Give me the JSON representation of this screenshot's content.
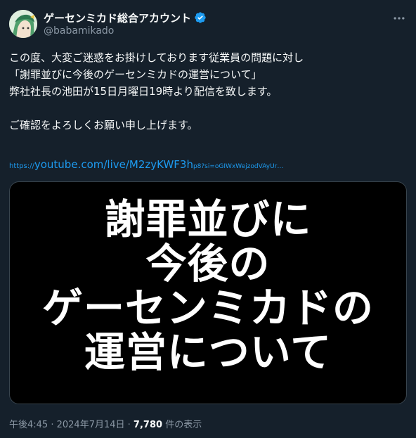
{
  "author": {
    "display_name": "ゲーセンミカド総合アカウント",
    "handle": "@babamikado",
    "verified_color": "#1d9bf0"
  },
  "tweet": {
    "lines": [
      "この度、大変ご迷惑をお掛けしております従業員の問題に対し",
      "「謝罪並びに今後のゲーセンミカドの運営について」",
      "弊社社長の池田が15日月曜日19時より配信を致します。",
      "",
      "ご確認をよろしくお願い申し上げます。"
    ],
    "link": {
      "protocol": "https://",
      "domain": "youtube.com/live/M2zyKWF3h",
      "rest": "p8?si=oGIWxWejzodVAyUr…"
    }
  },
  "media": {
    "title_lines": [
      "謝罪並びに",
      "今後の",
      "ゲーセンミカドの",
      "運営について"
    ]
  },
  "meta": {
    "time": "午後4:45",
    "separator": " · ",
    "date": "2024年7月14日",
    "views_count": "7,780",
    "views_label": "件の表示"
  },
  "colors": {
    "background": "#15202b",
    "text_primary": "#f7f9f9",
    "text_secondary": "#8b98a5",
    "accent": "#1d9bf0"
  },
  "icons": {
    "avatar": "avatar-illustration",
    "verified": "verified-badge-icon",
    "more": "more-options-icon"
  }
}
